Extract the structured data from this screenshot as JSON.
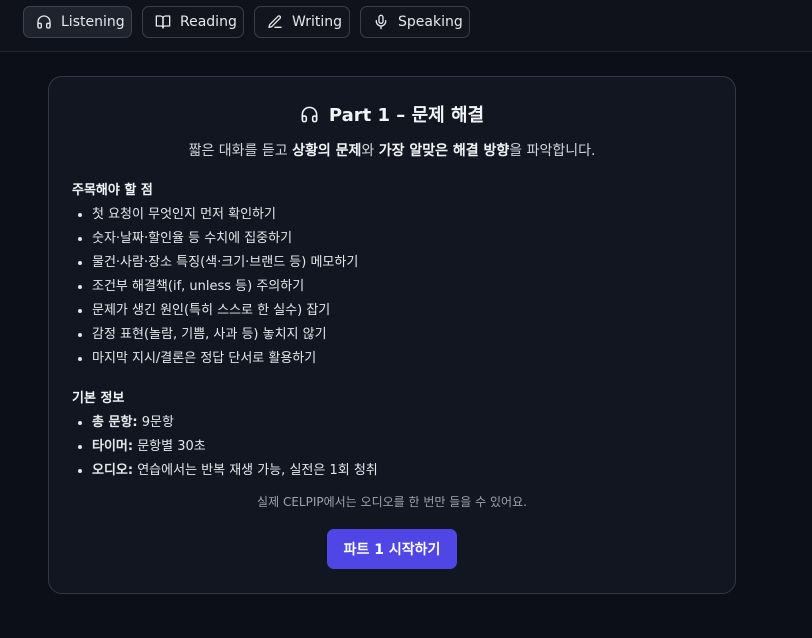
{
  "tabs": [
    {
      "label": "Listening",
      "icon": "headphones-icon",
      "active": true
    },
    {
      "label": "Reading",
      "icon": "book-open-icon",
      "active": false
    },
    {
      "label": "Writing",
      "icon": "pencil-icon",
      "active": false
    },
    {
      "label": "Speaking",
      "icon": "microphone-icon",
      "active": false
    }
  ],
  "card": {
    "title": "Part 1 – 문제 해결",
    "subtitle_parts": [
      "짧은 대화를 듣고 ",
      "상황의 문제",
      "와 ",
      "가장 알맞은 해결 방향",
      "을 파악합니다."
    ],
    "focus_heading": "주목해야 할 점",
    "focus_items": [
      "첫 요청이 무엇인지 먼저 확인하기",
      "숫자·날짜·할인율 등 수치에 집중하기",
      "물건·사람·장소 특징(색·크기·브랜드 등) 메모하기",
      "조건부 해결책(if, unless 등) 주의하기",
      "문제가 생긴 원인(특히 스스로 한 실수) 잡기",
      "감정 표현(놀람, 기쁨, 사과 등) 놓치지 않기",
      "마지막 지시/결론은 정답 단서로 활용하기"
    ],
    "info_heading": "기본 정보",
    "info_items": [
      {
        "label": "총 문항:",
        "value": " 9문항"
      },
      {
        "label": "타이머:",
        "value": " 문항별 30초"
      },
      {
        "label": "오디오:",
        "value": " 연습에서는 반복 재생 가능, 실전은 1회 청취"
      }
    ],
    "note": "실제 CELPIP에서는 오디오를 한 번만 들을 수 있어요.",
    "cta_label": "파트 1 시작하기"
  },
  "colors": {
    "accent": "#4f46e5",
    "background": "#0c0f18",
    "card": "#121620"
  }
}
